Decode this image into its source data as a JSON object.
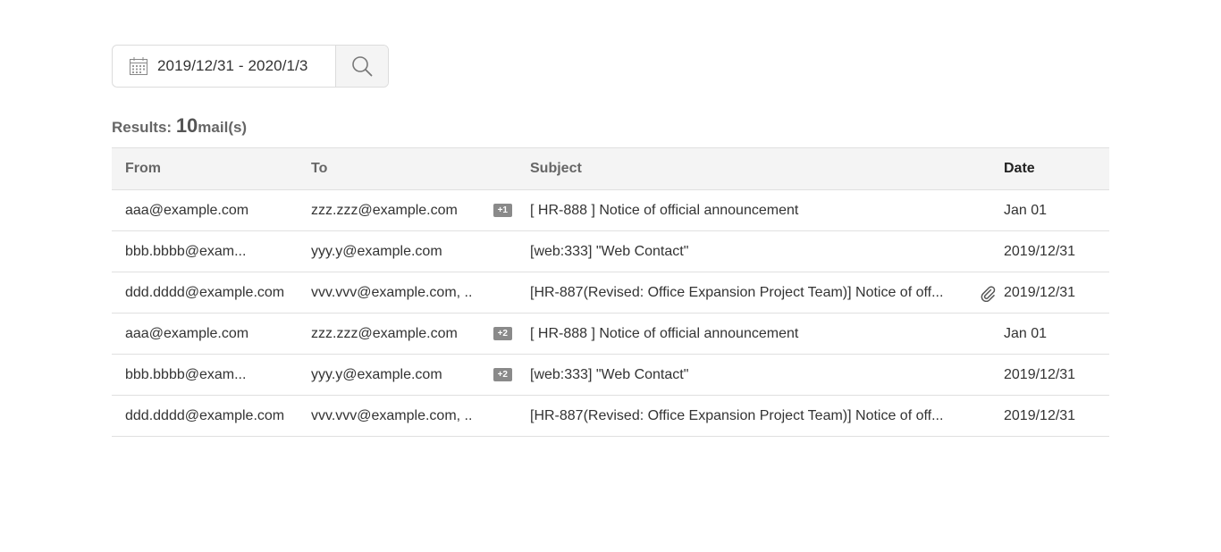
{
  "search": {
    "date_range": "2019/12/31 - 2020/1/3",
    "calendar_icon": "calendar-icon",
    "search_icon": "search-icon"
  },
  "results": {
    "label": "Results:",
    "count": "10",
    "unit": "mail(s)"
  },
  "table": {
    "headers": {
      "from": "From",
      "to": "To",
      "subject": "Subject",
      "date": "Date"
    },
    "rows": [
      {
        "from": "aaa@example.com",
        "to": "zzz.zzz@example.com",
        "badge": "+1",
        "subject": "[ HR-888 ] Notice of official announcement",
        "attachment": false,
        "date": "Jan 01"
      },
      {
        "from": "bbb.bbbb@exam...",
        "to": "yyy.y@example.com",
        "badge": "",
        "subject": "[web:333] \"Web Contact\"",
        "attachment": false,
        "date": "2019/12/31"
      },
      {
        "from": "ddd.dddd@example.com",
        "to": "vvv.vvv@example.com, ..",
        "badge": "",
        "subject": "[HR-887(Revised: Office Expansion Project Team)] Notice of off...",
        "attachment": true,
        "date": "2019/12/31"
      },
      {
        "from": "aaa@example.com",
        "to": "zzz.zzz@example.com",
        "badge": "+2",
        "subject": "[ HR-888 ] Notice of official announcement",
        "attachment": false,
        "date": "Jan 01"
      },
      {
        "from": "bbb.bbbb@exam...",
        "to": "yyy.y@example.com",
        "badge": "+2",
        "subject": "[web:333] \"Web Contact\"",
        "attachment": false,
        "date": "2019/12/31"
      },
      {
        "from": "ddd.dddd@example.com",
        "to": "vvv.vvv@example.com, ..",
        "badge": "",
        "subject": "[HR-887(Revised: Office Expansion Project Team)] Notice of off...",
        "attachment": false,
        "date": "2019/12/31"
      }
    ]
  }
}
